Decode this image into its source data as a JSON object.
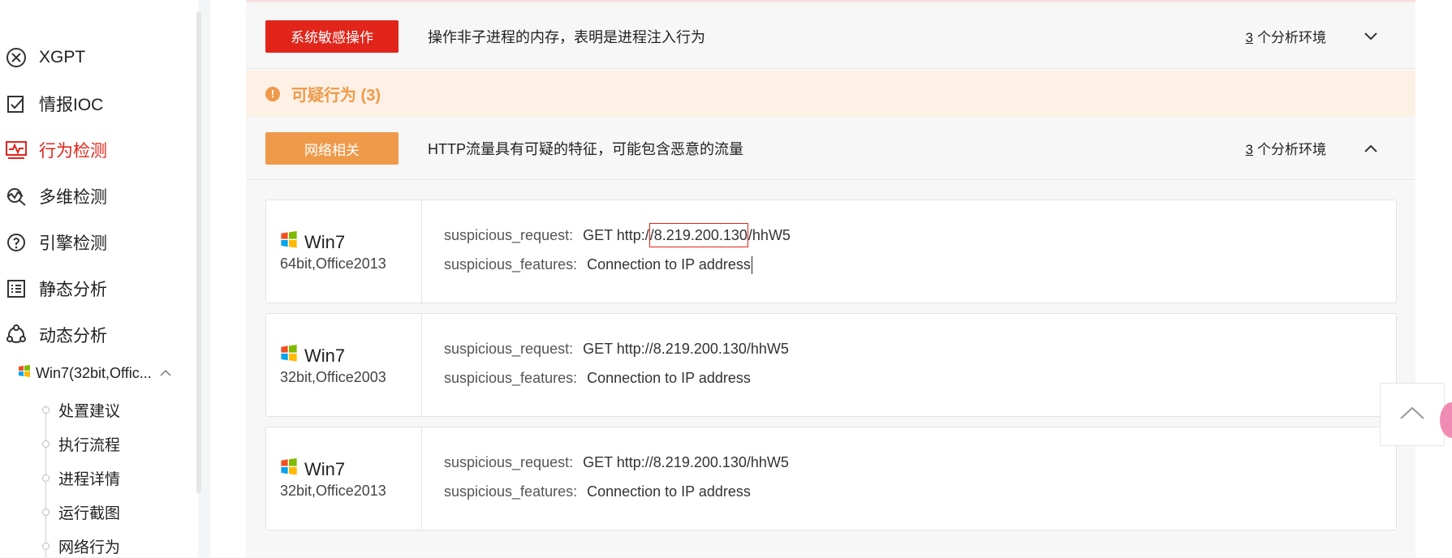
{
  "sidebar": {
    "items": [
      {
        "label": "XGPT",
        "icon": "xgpt-icon"
      },
      {
        "label": "情报IOC",
        "icon": "edit-check-icon"
      },
      {
        "label": "行为检测",
        "icon": "monitor-pulse-icon",
        "active": true
      },
      {
        "label": "多维检测",
        "icon": "multi-detect-icon"
      },
      {
        "label": "引擎检测",
        "icon": "engine-icon"
      },
      {
        "label": "静态分析",
        "icon": "list-icon"
      },
      {
        "label": "动态分析",
        "icon": "share-nodes-icon"
      }
    ],
    "env": {
      "label": "Win7(32bit,Offic...",
      "icon": "windows-logo-icon"
    },
    "tree": [
      "处置建议",
      "执行流程",
      "进程详情",
      "运行截图",
      "网络行为"
    ]
  },
  "rows": {
    "sensitive": {
      "tag": "系统敏感操作",
      "desc": "操作非子进程的内存，表明是进程注入行为",
      "count": "3",
      "count_suffix": "个分析环境",
      "tag_color": "#e1251b"
    },
    "network": {
      "tag": "网络相关",
      "desc": "HTTP流量具有可疑的特征，可能包含恶意的流量",
      "count": "3",
      "count_suffix": "个分析环境",
      "tag_color": "#ef9a4a"
    }
  },
  "section": {
    "title": "可疑行为 (3)",
    "icon": "exclamation-icon",
    "color": "#ef9a4a"
  },
  "cards": [
    {
      "os": "Win7",
      "spec": "64bit,Office2013",
      "req_label": "suspicious_request:",
      "req_pre": "GET http:/",
      "req_hl": "/8.219.200.130",
      "req_post": "/hhW5",
      "feat_label": "suspicious_features:",
      "feat_value": "Connection to IP address"
    },
    {
      "os": "Win7",
      "spec": "32bit,Office2003",
      "req_label": "suspicious_request:",
      "req_value": "GET http://8.219.200.130/hhW5",
      "feat_label": "suspicious_features:",
      "feat_value": "Connection to IP address"
    },
    {
      "os": "Win7",
      "spec": "32bit,Office2013",
      "req_label": "suspicious_request:",
      "req_value": "GET http://8.219.200.130/hhW5",
      "feat_label": "suspicious_features:",
      "feat_value": "Connection to IP address"
    }
  ],
  "back_to_top": {
    "icon": "chevron-up-icon"
  }
}
